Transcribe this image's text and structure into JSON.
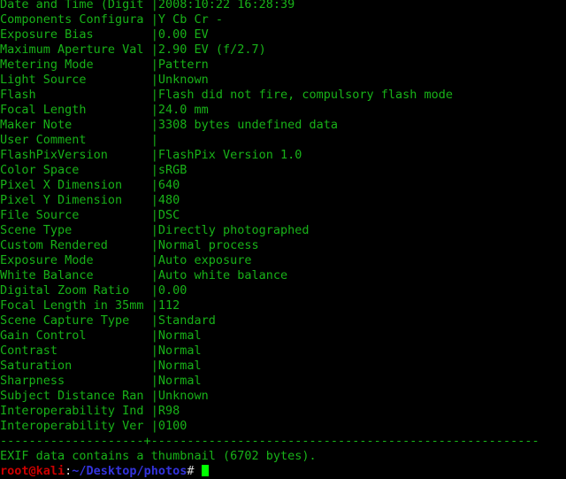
{
  "terminal": {
    "colors": {
      "background": "#000000",
      "foreground": "#18b218",
      "cursor": "#00ff00",
      "prompt_user": "#cc0000",
      "prompt_path": "#3333dd",
      "prompt_punct": "#d8d8d8"
    },
    "label_column_width": 21,
    "columns": 79,
    "rows": 31
  },
  "exif_table": {
    "rows": [
      {
        "label": "Date and Time (Digit",
        "value": "2008:10:22 16:28:39"
      },
      {
        "label": "Components Configura",
        "value": "Y Cb Cr -"
      },
      {
        "label": "Exposure Bias",
        "value": "0.00 EV"
      },
      {
        "label": "Maximum Aperture Val",
        "value": "2.90 EV (f/2.7)"
      },
      {
        "label": "Metering Mode",
        "value": "Pattern"
      },
      {
        "label": "Light Source",
        "value": "Unknown"
      },
      {
        "label": "Flash",
        "value": "Flash did not fire, compulsory flash mode"
      },
      {
        "label": "Focal Length",
        "value": "24.0 mm"
      },
      {
        "label": "Maker Note",
        "value": "3308 bytes undefined data"
      },
      {
        "label": "User Comment",
        "value": ""
      },
      {
        "label": "FlashPixVersion",
        "value": "FlashPix Version 1.0"
      },
      {
        "label": "Color Space",
        "value": "sRGB"
      },
      {
        "label": "Pixel X Dimension",
        "value": "640"
      },
      {
        "label": "Pixel Y Dimension",
        "value": "480"
      },
      {
        "label": "File Source",
        "value": "DSC"
      },
      {
        "label": "Scene Type",
        "value": "Directly photographed"
      },
      {
        "label": "Custom Rendered",
        "value": "Normal process"
      },
      {
        "label": "Exposure Mode",
        "value": "Auto exposure"
      },
      {
        "label": "White Balance",
        "value": "Auto white balance"
      },
      {
        "label": "Digital Zoom Ratio",
        "value": "0.00"
      },
      {
        "label": "Focal Length in 35mm",
        "value": "112"
      },
      {
        "label": "Scene Capture Type",
        "value": "Standard"
      },
      {
        "label": "Gain Control",
        "value": "Normal"
      },
      {
        "label": "Contrast",
        "value": "Normal"
      },
      {
        "label": "Saturation",
        "value": "Normal"
      },
      {
        "label": "Sharpness",
        "value": "Normal"
      },
      {
        "label": "Subject Distance Ran",
        "value": "Unknown"
      },
      {
        "label": "Interoperability Ind",
        "value": "R98"
      },
      {
        "label": "Interoperability Ver",
        "value": "0100"
      }
    ]
  },
  "separator": "--------------------+------------------------------------------------------",
  "status_message": "EXIF data contains a thumbnail (6702 bytes).",
  "prompt": {
    "user_host": "root@kali",
    "colon": ":",
    "path": "~/Desktop/photos",
    "sigil": "#",
    "space": " ",
    "command": ""
  }
}
